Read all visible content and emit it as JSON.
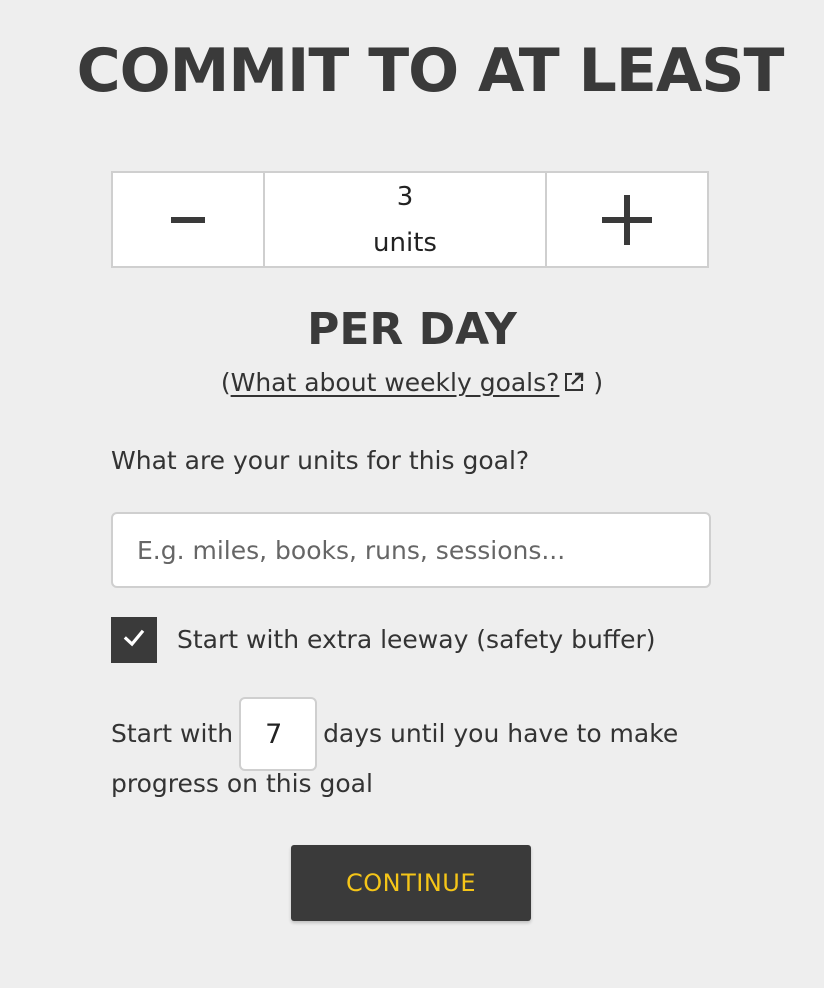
{
  "header": {
    "title": "COMMIT TO AT LEAST"
  },
  "stepper": {
    "value": "3",
    "unit_label": "units",
    "decrement_icon": "minus-icon",
    "increment_icon": "plus-icon"
  },
  "rate": {
    "label": "PER DAY",
    "paren_open": "(",
    "weekly_link": "What about weekly goals?",
    "paren_close": ")",
    "weekly_link_icon": "external-link-icon"
  },
  "units": {
    "label": "What are your units for this goal?",
    "placeholder": "E.g. miles, books, runs, sessions...",
    "value": ""
  },
  "leeway": {
    "checked": true,
    "label": "Start with extra leeway (safety buffer)"
  },
  "buffer": {
    "prefix": "Start with",
    "days_value": "7",
    "suffix": "days until you have to make",
    "suffix_line2": "progress on this goal"
  },
  "actions": {
    "continue_label": "CONTINUE"
  },
  "colors": {
    "background": "#eeeeee",
    "dark": "#3a3a3a",
    "accent": "#f5c518"
  }
}
